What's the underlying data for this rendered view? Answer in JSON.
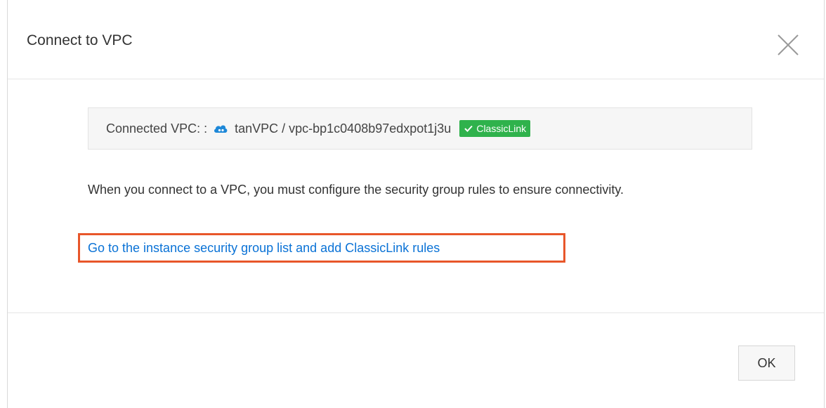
{
  "dialog": {
    "title": "Connect to VPC",
    "close_icon": "close-icon"
  },
  "vpc_info": {
    "label": "Connected VPC: :",
    "icon": "cloud-icon",
    "icon_color": "#1e88d8",
    "name": "tanVPC / vpc-bp1c0408b97edxpot1j3u",
    "badge_label": "ClassicLink",
    "badge_icon": "check-icon",
    "badge_color": "#2fb24c"
  },
  "description": "When you connect to a VPC, you must configure the security group rules to ensure connectivity.",
  "link": {
    "label": "Go to the instance security group list and add ClassicLink rules",
    "color": "#0a72d6",
    "highlight_color": "#e8562a"
  },
  "footer": {
    "ok_label": "OK"
  }
}
